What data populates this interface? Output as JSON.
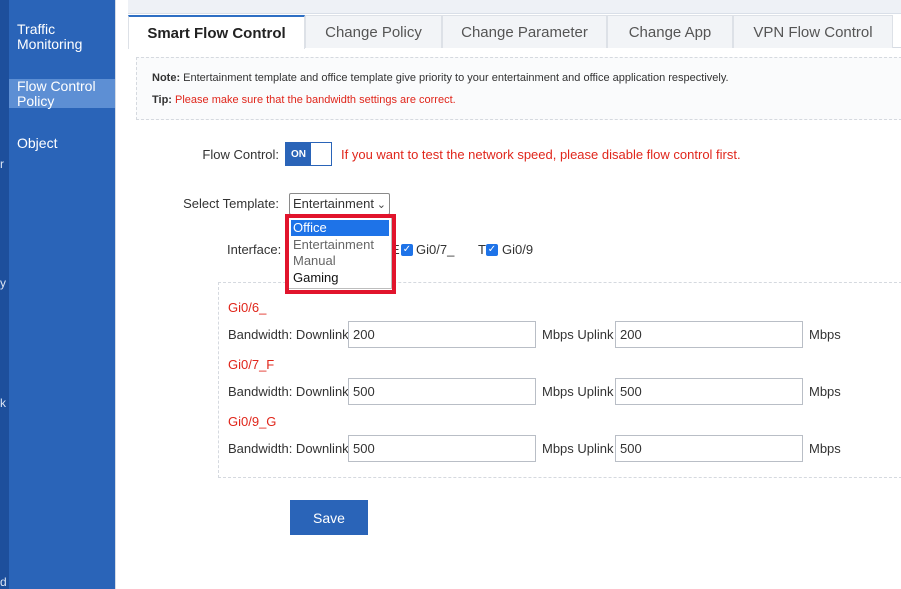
{
  "left_strip": {
    "fragments": [
      "r",
      "y",
      "k",
      "d"
    ]
  },
  "sidebar": {
    "items": [
      {
        "lines": [
          "Traffic",
          "Monitoring"
        ],
        "active": false
      },
      {
        "lines": [
          "Flow Control",
          "Policy"
        ],
        "active": true
      },
      {
        "lines": [
          "Object"
        ],
        "active": false
      }
    ]
  },
  "tabs": [
    "Smart Flow Control",
    "Change Policy",
    "Change Parameter",
    "Change App",
    "VPN Flow Control"
  ],
  "note": {
    "note_label": "Note:",
    "note_text": " Entertainment template and office template give priority to your entertainment and office application respectively.",
    "tip_label": "Tip:",
    "tip_text": " Please make sure that the bandwidth settings are correct."
  },
  "flow_control": {
    "label": "Flow Control:",
    "toggle": "ON",
    "warning": "If you want to test the network speed, please disable flow control first."
  },
  "template": {
    "label": "Select Template:",
    "selected": "Entertainment",
    "options": [
      "Office",
      "Entertainment",
      "Manual",
      "Gaming"
    ]
  },
  "interface": {
    "label": "Interface:",
    "partial_char": "E",
    "items": [
      {
        "name": "Gi0/7_",
        "checked": true
      },
      {
        "name": "Gi0/9",
        "checked": true
      }
    ],
    "partial_char2": "T"
  },
  "ports": [
    {
      "name": "Gi0/6_",
      "bw_label": "Bandwidth: Downlink",
      "downlink": "200",
      "uplink_label": "Mbps Uplink",
      "uplink": "200",
      "unit": "Mbps"
    },
    {
      "name": "Gi0/7_F",
      "bw_label": "Bandwidth: Downlink",
      "downlink": "500",
      "uplink_label": "Mbps Uplink",
      "uplink": "500",
      "unit": "Mbps"
    },
    {
      "name": "Gi0/9_G",
      "bw_label": "Bandwidth: Downlink",
      "downlink": "500",
      "uplink_label": "Mbps Uplink",
      "uplink": "500",
      "unit": "Mbps"
    }
  ],
  "save_label": "Save",
  "colors": {
    "sidebar": "#2a64b8",
    "active_item": "#5d8fd4",
    "warning": "#e0261b",
    "highlight": "#e1142c",
    "selected_option": "#1e73e8"
  }
}
